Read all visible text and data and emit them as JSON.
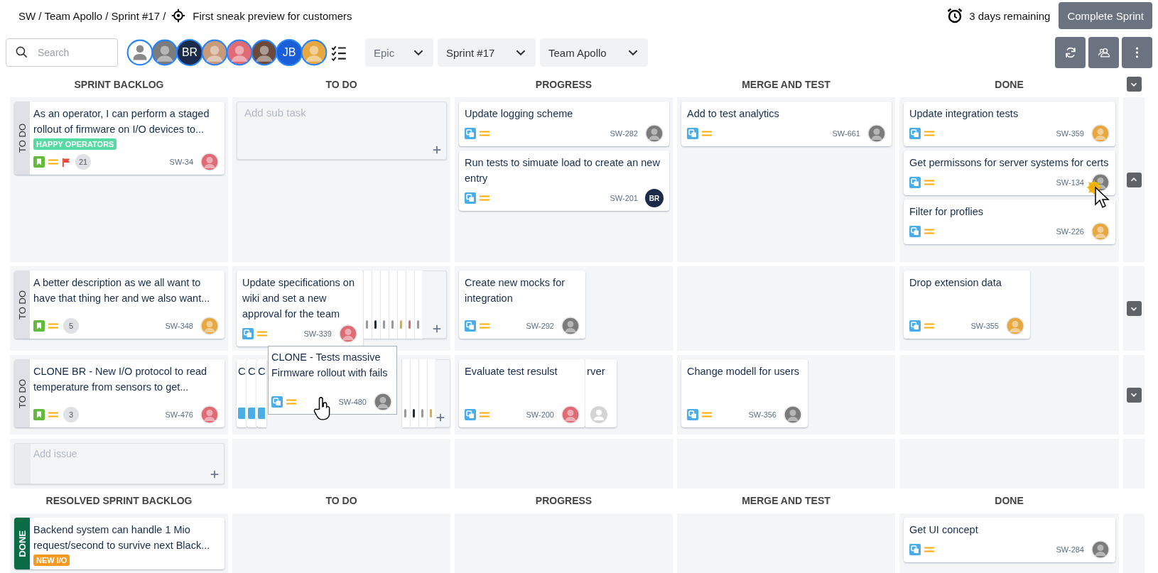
{
  "header": {
    "path": "SW / Team Apollo / Sprint #17 /",
    "goal": "First sneak preview for customers",
    "remaining": "3 days remaining",
    "button": "Complete Sprint"
  },
  "search": {
    "placeholder": "Search"
  },
  "people": [
    {
      "kind": "anon",
      "color": "#8a8a8a"
    },
    {
      "kind": "photo",
      "color": "#7b7b7b"
    },
    {
      "kind": "initials",
      "text": "BR",
      "color": "#1c2b4a"
    },
    {
      "kind": "photo",
      "color": "#c89a78"
    },
    {
      "kind": "photo",
      "color": "#e06b75"
    },
    {
      "kind": "photo",
      "color": "#6b4a3a"
    },
    {
      "kind": "initials",
      "text": "JB",
      "color": "#1a5ed8"
    },
    {
      "kind": "photo",
      "color": "#e8a840"
    }
  ],
  "filters": [
    {
      "label": "Epic",
      "empty": true
    },
    {
      "label": "Sprint #17",
      "empty": false
    },
    {
      "label": "Team Apollo",
      "empty": false
    }
  ],
  "header_toggle": {
    "expanded": false
  },
  "sections": [
    {
      "columns": [
        "SPRINT BACKLOG",
        "TO DO",
        "PROGRESS",
        "MERGE AND TEST",
        "DONE"
      ],
      "lanes": [
        {
          "status": "TO DO",
          "color": "#dfe1e6",
          "kind": "list",
          "expanded": true,
          "cells": [
            {
              "cards": [
                {
                  "title": "As an operator, I can perform a staged rollout of firmware on I/O devices to...",
                  "tag": {
                    "text": "HAPPY OPERATORS",
                    "color": "#57d9a3"
                  },
                  "kind": "story",
                  "flagged": true,
                  "count": "21",
                  "key": "SW-34",
                  "avatar": {
                    "kind": "photo",
                    "color": "#e06b75"
                  }
                }
              ]
            },
            {
              "add": true,
              "placeholder": "Add sub task"
            },
            {
              "cards": [
                {
                  "title": "Update logging scheme",
                  "kind": "subtask",
                  "flagged": false,
                  "key": "SW-282",
                  "avatar": {
                    "kind": "photo",
                    "color": "#7b7b7b"
                  }
                },
                {
                  "title": "Run tests to simuate load to create an new entry",
                  "kind": "subtask",
                  "flagged": false,
                  "key": "SW-201",
                  "avatar": {
                    "kind": "initials",
                    "text": "BR",
                    "color": "#1c2b4a"
                  }
                }
              ]
            },
            {
              "cards": [
                {
                  "title": "Add to test analytics",
                  "kind": "subtask",
                  "flagged": false,
                  "key": "SW-661",
                  "avatar": {
                    "kind": "photo",
                    "color": "#7b7b7b"
                  }
                }
              ]
            },
            {
              "cards": [
                {
                  "title": "Update integration tests",
                  "kind": "subtask",
                  "flagged": false,
                  "key": "SW-359",
                  "avatar": {
                    "kind": "photo",
                    "color": "#e8a840"
                  }
                },
                {
                  "title": "Get permissons for server systems for certs",
                  "kind": "subtask",
                  "flagged": false,
                  "key": "SW-134",
                  "avatar": {
                    "kind": "photo",
                    "color": "#7b7b7b"
                  }
                },
                {
                  "title": "Filter for proflies",
                  "kind": "subtask",
                  "flagged": false,
                  "key": "SW-226",
                  "avatar": {
                    "kind": "photo",
                    "color": "#e8a840"
                  }
                }
              ]
            }
          ]
        },
        {
          "status": "TO DO",
          "color": "#dfe1e6",
          "kind": "tiles",
          "expanded": false,
          "cells": [
            {
              "cards": [
                {
                  "title": "A better description as we all want to have that thing her and we also want...",
                  "kind": "story",
                  "flagged": false,
                  "count": "5",
                  "key": "SW-348",
                  "avatar": {
                    "kind": "photo",
                    "color": "#e8a840"
                  }
                }
              ]
            },
            {
              "add": true,
              "cards": [
                {
                  "title": "Update specifications on wiki and set a new approval for the team",
                  "kind": "subtask",
                  "flagged": false,
                  "key": "SW-339",
                  "avatar": {
                    "kind": "photo",
                    "color": "#e06b75"
                  }
                }
              ],
              "stack": [
                {
                  "color": "#9a9a9a"
                },
                {
                  "color": "#1c2b4a"
                },
                {
                  "color": "#9a9a9a"
                },
                {
                  "color": "#9a9a9a"
                },
                {
                  "color": "#e8a840"
                },
                {
                  "color": "#e06b75"
                },
                {
                  "color": "#9a9a9a"
                }
              ]
            },
            {
              "cards": [
                {
                  "title": "Create new mocks for integration",
                  "kind": "subtask",
                  "flagged": false,
                  "key": "SW-292",
                  "avatar": {
                    "kind": "photo",
                    "color": "#7b7b7b"
                  }
                }
              ]
            },
            {},
            {
              "cards": [
                {
                  "title": "Drop extension data",
                  "kind": "subtask",
                  "flagged": false,
                  "key": "SW-355",
                  "avatar": {
                    "kind": "photo",
                    "color": "#e8a840"
                  }
                }
              ]
            }
          ]
        },
        {
          "status": "TO DO",
          "color": "#dfe1e6",
          "kind": "tiles",
          "expanded": false,
          "cells": [
            {
              "cards": [
                {
                  "title": "CLONE BR - New I/O protocol to read temperature from sensors to get...",
                  "kind": "story",
                  "flagged": false,
                  "count": "3",
                  "key": "SW-476",
                  "avatar": {
                    "kind": "photo",
                    "color": "#e06b75"
                  }
                }
              ]
            },
            {
              "add": true,
              "fragments": [
                "C",
                "C",
                "C"
              ],
              "stack": [
                {
                  "color": "#9a9a9a"
                },
                {
                  "color": "#1c2b4a"
                },
                {
                  "color": "#9a9a9a"
                },
                {
                  "color": "#e8a840"
                }
              ],
              "dragging": {
                "title": "CLONE - Tests massive Firmware rollout with fails",
                "kind": "subtask",
                "key": "SW-480",
                "avatar": {
                  "kind": "photo",
                  "color": "#7b7b7b"
                }
              }
            },
            {
              "cards": [
                {
                  "title": "Evaluate test resulst",
                  "kind": "subtask",
                  "flagged": false,
                  "key": "SW-200",
                  "avatar": {
                    "kind": "photo",
                    "color": "#e06b75"
                  }
                }
              ],
              "behind": {
                "fragment": "rver",
                "avatar": {
                  "kind": "anon",
                  "color": "#d4d4d4"
                }
              }
            },
            {
              "cards": [
                {
                  "title": "Change modell for users",
                  "kind": "subtask",
                  "flagged": false,
                  "key": "SW-356",
                  "avatar": {
                    "kind": "photo",
                    "color": "#7b7b7b"
                  }
                }
              ]
            },
            {}
          ]
        },
        {
          "color": "#e9ebee",
          "kind": "add",
          "cells": [
            {
              "add": true,
              "placeholder": "Add issue"
            },
            {},
            {},
            {},
            {}
          ]
        }
      ]
    },
    {
      "columns": [
        "RESOLVED SPRINT BACKLOG",
        "TO DO",
        "PROGRESS",
        "MERGE AND TEST",
        "DONE"
      ],
      "lanes": [
        {
          "status": "DONE",
          "color": "#0a6b47",
          "kind": "list",
          "cells": [
            {
              "cards": [
                {
                  "title": "Backend system can handle 1 Mio request/second to survive next Black...",
                  "tag": {
                    "text": "NEW I/O",
                    "color": "#f79a1f"
                  }
                }
              ]
            },
            {},
            {},
            {},
            {
              "cards": [
                {
                  "title": "Get UI concept",
                  "kind": "subtask",
                  "flagged": false,
                  "key": "SW-284",
                  "avatar": {
                    "kind": "photo",
                    "color": "#7b7b7b"
                  }
                }
              ]
            }
          ]
        }
      ]
    }
  ]
}
